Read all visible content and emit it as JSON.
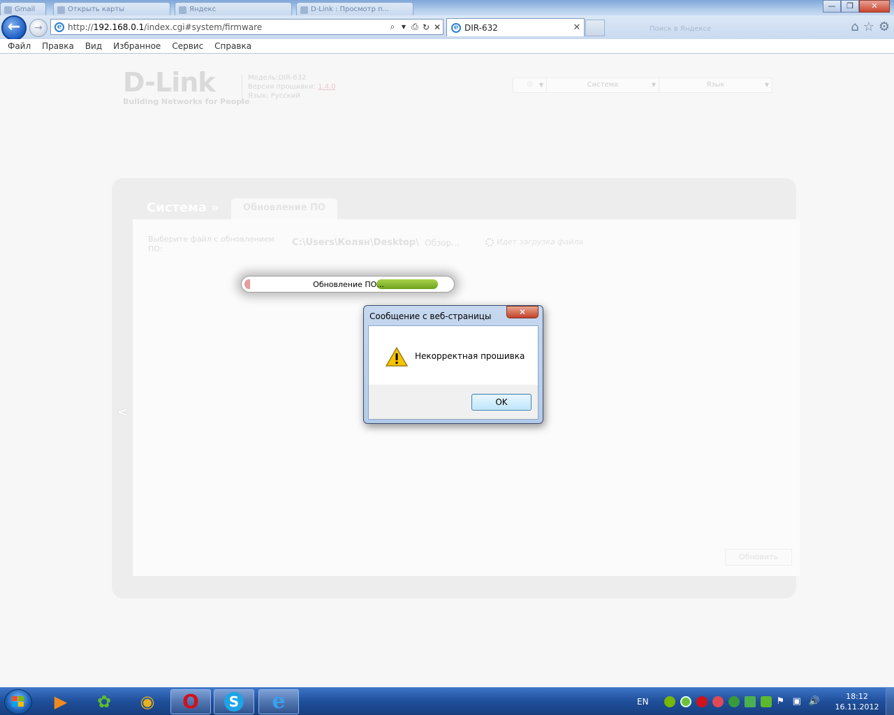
{
  "window": {
    "bg_tabs": [
      "Gmail",
      "Открыть карты",
      "Яндекс",
      "D-Link : Просмотр п..."
    ],
    "minimize": "—",
    "maximize": "❐",
    "close": "✕"
  },
  "nav": {
    "url_prefix": "http://",
    "url_host": "192.168.0.1",
    "url_path": "/index.cgi#system/firmware",
    "tab_title": "DIR-632",
    "tab_close": "✕",
    "faded_toolbar": "Поиск в Яндексе"
  },
  "menu": [
    "Файл",
    "Правка",
    "Вид",
    "Избранное",
    "Сервис",
    "Справка"
  ],
  "router": {
    "logo_word": "D-Link",
    "logo_tagline": "Building Networks for People",
    "model_line": "Модель:DIR-632",
    "fw_prefix": "Версия прошивки:",
    "fw_version": "1.4.0",
    "lang_line": "Язык: Русский",
    "top_system": "Система",
    "top_language": "Язык"
  },
  "panel": {
    "title": "Система »",
    "tab": "Обновление ПО",
    "file_label": "Выберите файл с обновлением ПО:",
    "file_path": "C:\\Users\\Колян\\Desktop\\",
    "browse": "Обзор...",
    "status": "Идет загрузка файла",
    "update_button": "Обновить"
  },
  "progress": {
    "label": "Обновление ПО...",
    "fraction": 0.29
  },
  "dialog": {
    "title": "Сообщение с веб-страницы",
    "message": "Некорректная прошивка",
    "ok": "OK",
    "close": "✕"
  },
  "taskbar": {
    "lang": "EN",
    "time": "18:12",
    "date": "16.11.2012"
  },
  "colors": {
    "accent_blue": "#1d5ec4",
    "progress_green": "#7fb325",
    "taskbar": "#1f4f9a",
    "warning_yellow": "#f5c400"
  }
}
